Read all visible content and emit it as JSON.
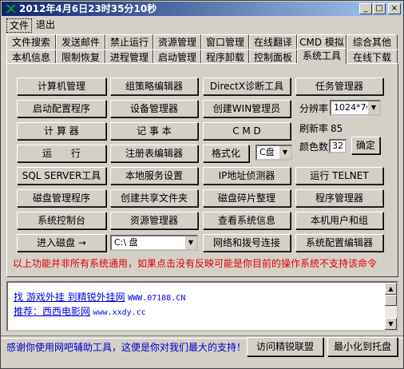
{
  "window": {
    "title": "2012年4月6日23时35分10秒",
    "minimize_glyph": "_",
    "maximize_glyph": "□",
    "close_glyph": "×"
  },
  "menu": [
    "文件",
    "退出"
  ],
  "tabs_row1": [
    "文件搜索",
    "发送邮件",
    "禁止运行",
    "资源管理",
    "窗口管理",
    "在线翻译",
    "CMD 模拟",
    "综合其他"
  ],
  "tabs_row2": [
    "本机信息",
    "限制恢复",
    "进程管理",
    "启动管理",
    "程序卸载",
    "控制面板",
    "系统工具",
    "在线下载"
  ],
  "active_tab": "系统工具",
  "buttons": {
    "computer_mgmt": "计算机管理",
    "group_policy": "组策略编辑器",
    "directx_diag": "DirectX诊断工具",
    "task_mgr": "任务管理器",
    "startup_config": "启动配置程序",
    "device_mgr": "设备管理器",
    "create_admin": "创建WIN管理员",
    "calculator": "计 算 器",
    "notepad": "记 事 本",
    "cmd": "C M D",
    "run": "运　　行",
    "regedit": "注册表编辑器",
    "format": "格式化",
    "sql_server": "SQL SERVER工具",
    "local_services": "本地服务设置",
    "ip_scanner": "IP地址侦测器",
    "telnet": "运行 TELNET",
    "disk_mgmt": "磁盘管理程序",
    "share_folder": "创建共享文件夹",
    "defrag": "磁盘碎片整理",
    "program_mgr": "程序管理器",
    "console": "系统控制台",
    "explorer": "资源管理器",
    "sysinfo": "查看系统信息",
    "users_groups": "本机用户和组",
    "enter_disk": "进入磁盘 →",
    "network_dialup": "网络和拨号连接",
    "sysconfig": "系统配置编辑器",
    "confirm": "确定",
    "visit_union": "访问精锐联盟",
    "minimize_tray": "最小化到托盘"
  },
  "display": {
    "resolution_label": "分辨率",
    "resolution_value": "1024*76",
    "refresh_label": "刷新率",
    "refresh_value": "85",
    "color_label": "颜色数",
    "color_value": "32"
  },
  "format_drive": "C盘",
  "disk_path": "C:\\      盘",
  "note": "以上功能并非所有系统通用，如果点击没有反映可能是你目前的操作系统不支持该命令",
  "links": [
    {
      "text": "找 游戏外挂 到精锐外挂网",
      "url": "WWW.07188.CN"
    },
    {
      "text": "推荐：西西电影网",
      "url": "www.xxdy.cc"
    }
  ],
  "thanks": "感谢你使用网吧辅助工具，这便是你对我们最大的支持！",
  "colors": {
    "titlebar_start": "#0a246a",
    "note_red": "#e00000",
    "link_blue": "#0000ee"
  }
}
